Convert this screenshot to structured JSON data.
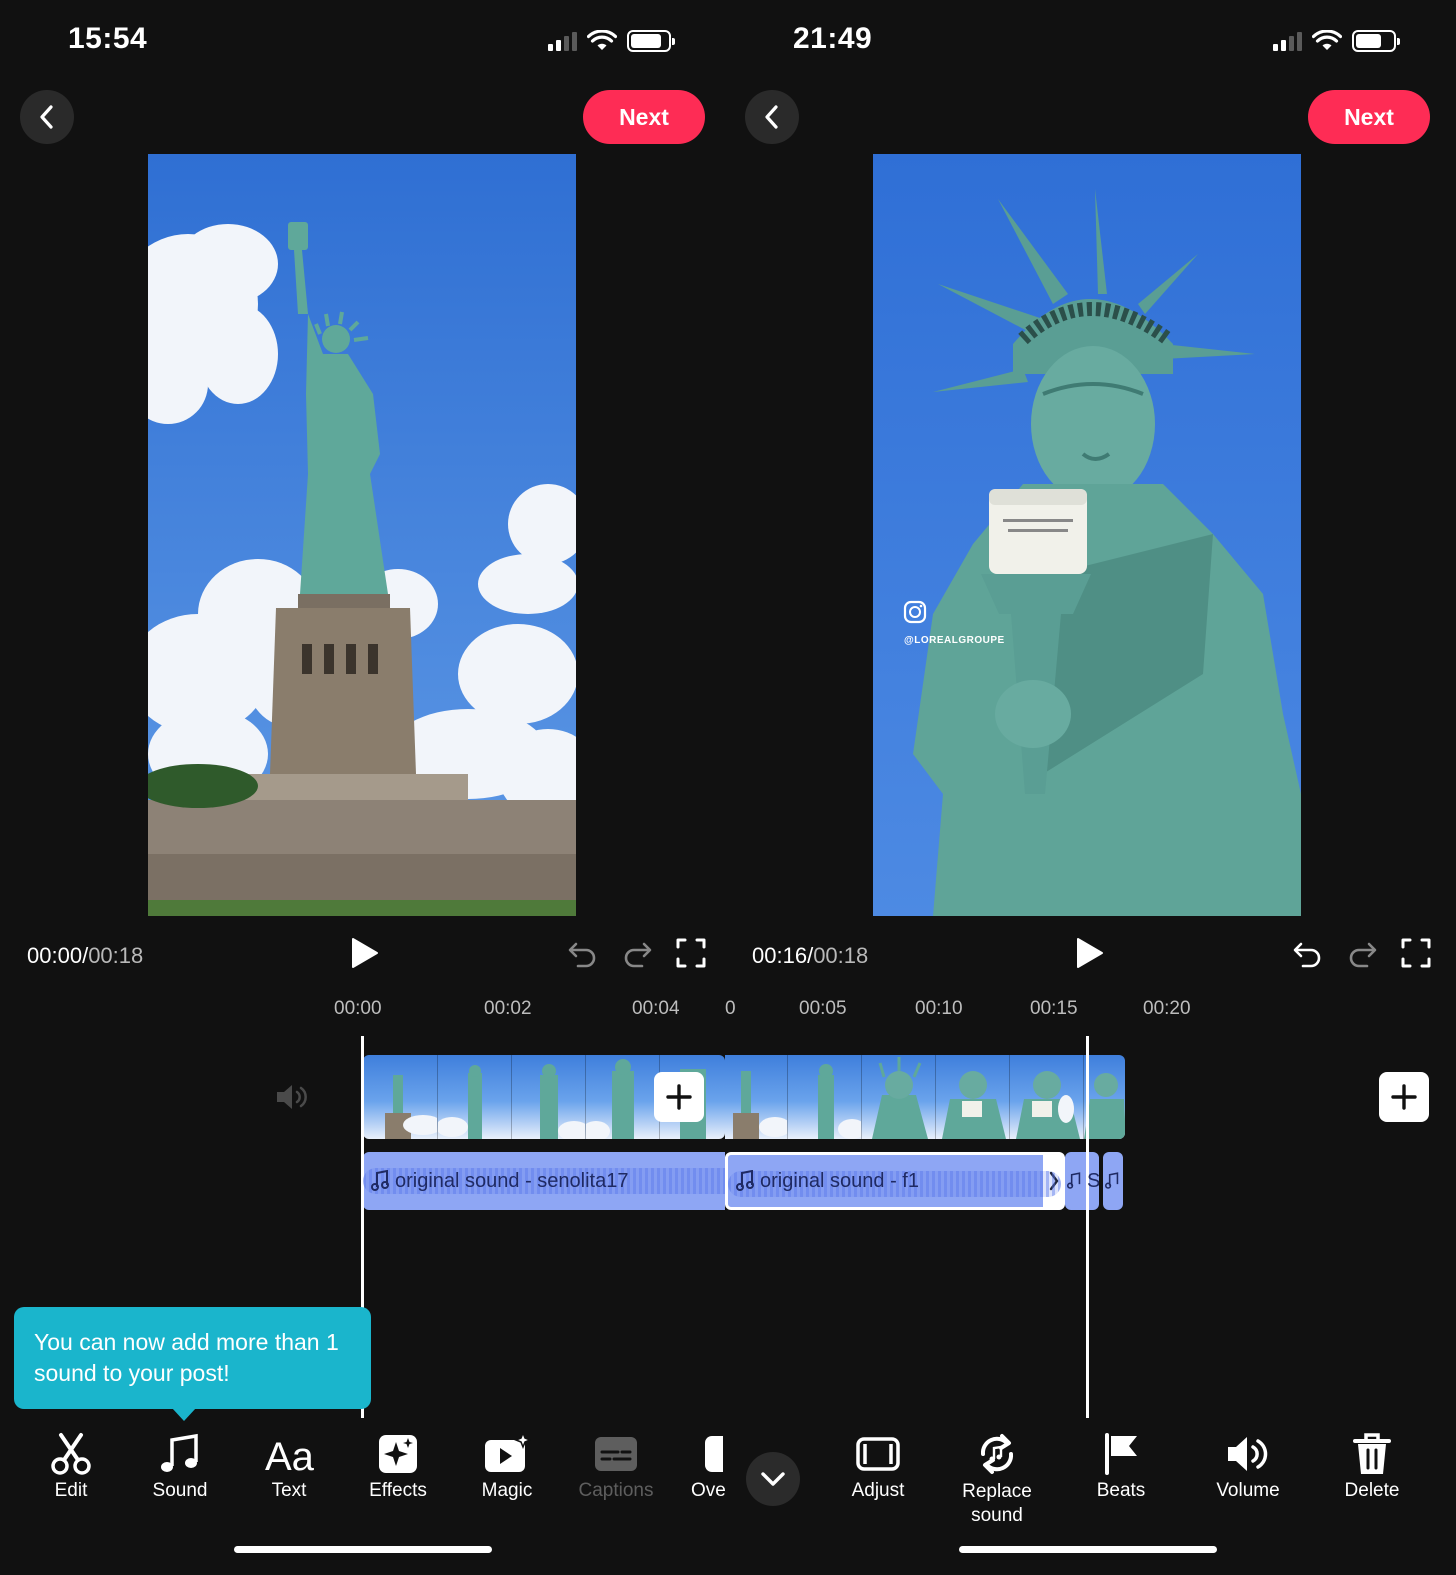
{
  "left_screen": {
    "status_time": "15:54",
    "next_label": "Next",
    "timecode_current": "00:00",
    "timecode_separator": "/",
    "timecode_total": "00:18",
    "ruler_ticks": [
      "00:00",
      "00:02",
      "00:04"
    ],
    "audio_track_label": "original sound - senolita17",
    "tooltip_text": "You can now add more than 1 sound to your post!",
    "toolbar": [
      {
        "label": "Edit",
        "icon": "scissors-icon"
      },
      {
        "label": "Sound",
        "icon": "music-note-icon"
      },
      {
        "label": "Text",
        "icon": "text-aa-icon"
      },
      {
        "label": "Effects",
        "icon": "effects-sparkle-icon"
      },
      {
        "label": "Magic",
        "icon": "magic-play-icon"
      },
      {
        "label": "Captions",
        "icon": "captions-icon",
        "disabled": true
      },
      {
        "label": "Ove",
        "icon": "overlay-icon"
      }
    ]
  },
  "right_screen": {
    "status_time": "21:49",
    "next_label": "Next",
    "timecode_current": "00:16",
    "timecode_separator": "/",
    "timecode_total": "00:18",
    "ruler_ticks": [
      "0",
      "00:05",
      "00:10",
      "00:15",
      "00:20"
    ],
    "audio_track_label": "original sound - f1",
    "audio_track_more": "S",
    "video_watermark": "@LOREALGROUPE",
    "toolbar": [
      {
        "label": "Adjust",
        "icon": "adjust-frame-icon"
      },
      {
        "label": "Replace sound",
        "icon": "replace-sound-icon"
      },
      {
        "label": "Beats",
        "icon": "flag-beats-icon"
      },
      {
        "label": "Volume",
        "icon": "volume-icon"
      },
      {
        "label": "Delete",
        "icon": "trash-icon"
      }
    ]
  },
  "colors": {
    "background": "#111111",
    "next_button": "#fe2c55",
    "tooltip": "#1ab5cc",
    "audio_track": "#8ea6f4",
    "sky": "#3f7fdc",
    "statue": "#5fa89a"
  }
}
